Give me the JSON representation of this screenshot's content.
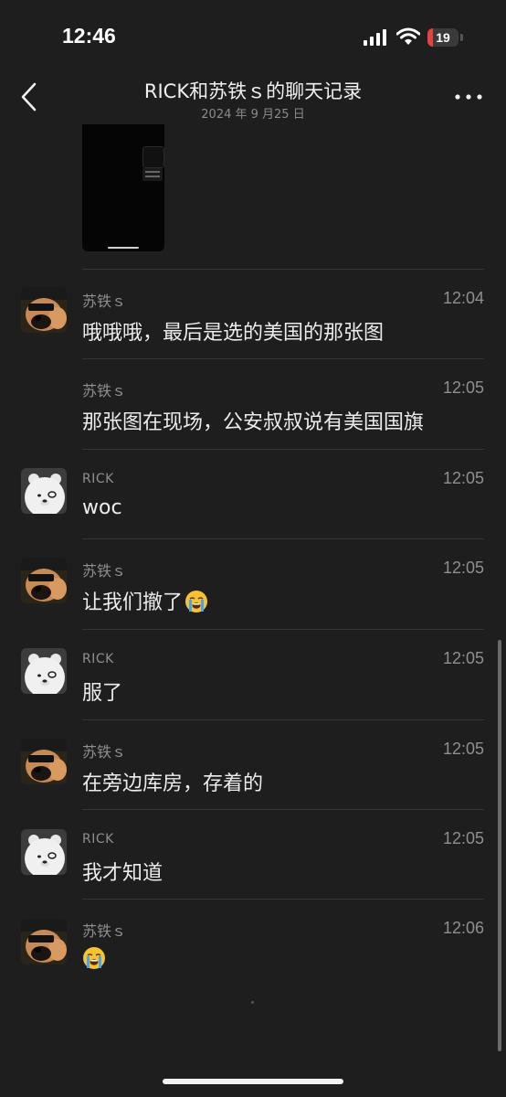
{
  "status": {
    "time": "12:46",
    "battery": "19",
    "battery_level": 0.19
  },
  "header": {
    "title": "RICK和苏铁ｓ的聊天记录",
    "date": "2024 年 9 月25 日"
  },
  "icons": {
    "back": "chevron-left-icon",
    "more": "ellipsis-icon",
    "crying": "loudly-crying-face-emoji"
  },
  "messages": [
    {
      "sender": "苏铁ｓ",
      "time": "12:04",
      "text": "哦哦哦，最后是选的美国的那张图",
      "avatar": "dog-avatar"
    },
    {
      "sender": "苏铁ｓ",
      "time": "12:05",
      "text": "那张图在现场，公安叔叔说有美国国旗",
      "avatar": ""
    },
    {
      "sender": "RICK",
      "time": "12:05",
      "text": "woc",
      "avatar": "bear-avatar"
    },
    {
      "sender": "苏铁ｓ",
      "time": "12:05",
      "text": "让我们撤了",
      "emoji": "crying",
      "avatar": "dog-avatar"
    },
    {
      "sender": "RICK",
      "time": "12:05",
      "text": "服了",
      "avatar": "bear-avatar"
    },
    {
      "sender": "苏铁ｓ",
      "time": "12:05",
      "text": "在旁边库房，存着的",
      "avatar": "dog-avatar"
    },
    {
      "sender": "RICK",
      "time": "12:05",
      "text": "我才知道",
      "avatar": "bear-avatar"
    },
    {
      "sender": "苏铁ｓ",
      "time": "12:06",
      "text": "",
      "emoji": "crying",
      "avatar": "dog-avatar"
    }
  ],
  "colors": {
    "background": "#1e1e1e",
    "text": "#ececec",
    "meta": "#8f8f8f",
    "battery_low": "#e0453f"
  }
}
